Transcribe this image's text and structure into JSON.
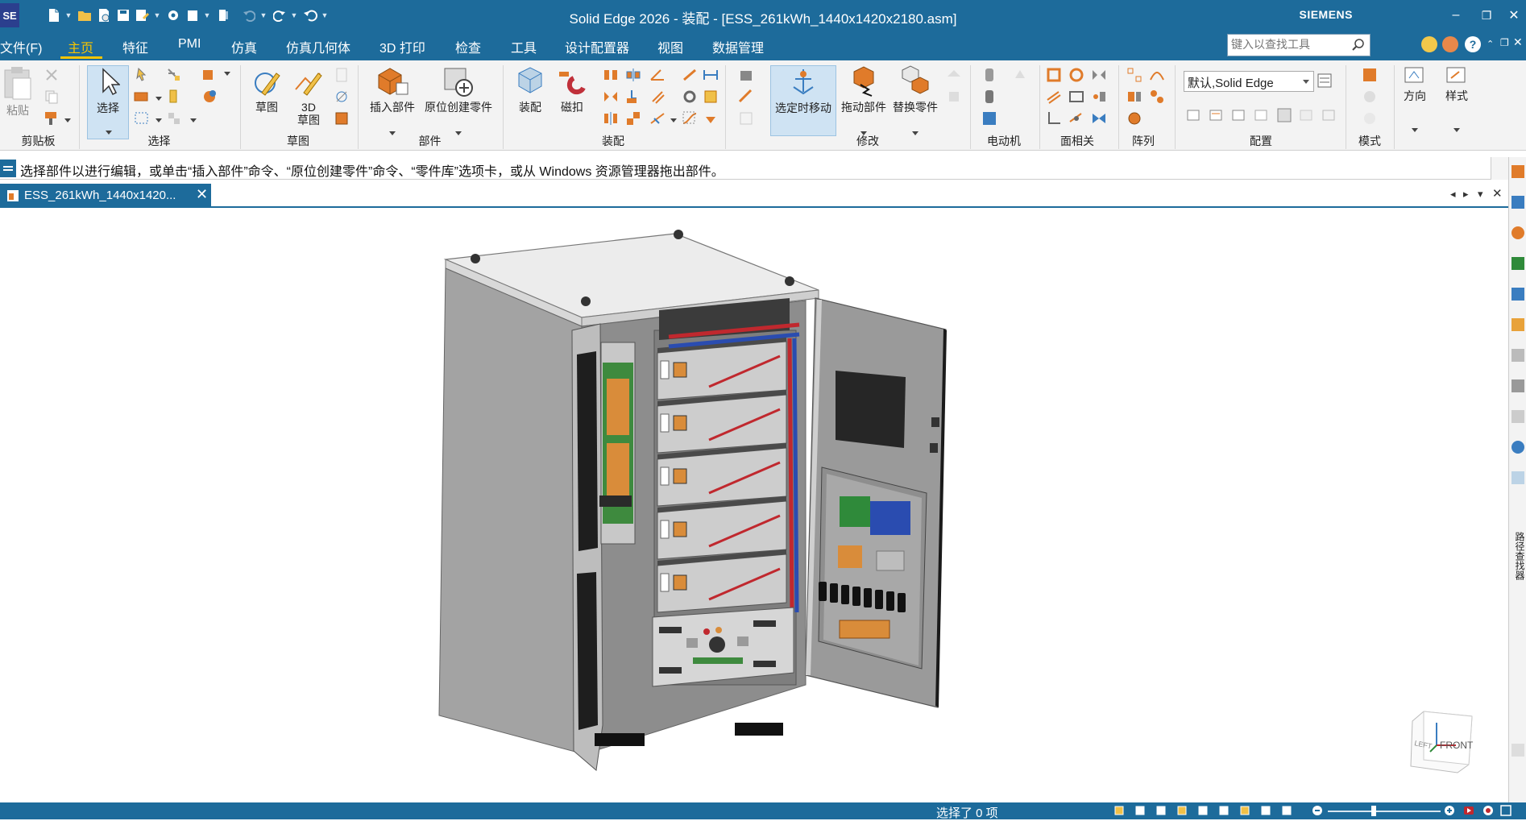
{
  "window": {
    "app_logo": "SE",
    "title": "Solid Edge 2026 - 装配 - [ESS_261kWh_1440x1420x2180.asm]",
    "brand": "SIEMENS",
    "minimize": "–",
    "restore": "❐",
    "close": "✕"
  },
  "menu": {
    "file": "文件(F)",
    "tabs": [
      "主页",
      "特征",
      "PMI",
      "仿真",
      "仿真几何体",
      "3D 打印",
      "检查",
      "工具",
      "设计配置器",
      "视图",
      "数据管理"
    ],
    "search_placeholder": "键入以查找工具"
  },
  "ribbon": {
    "groups": {
      "clipboard": "剪贴板",
      "select": "选择",
      "sketch": "草图",
      "parts": "部件",
      "assemble": "装配",
      "modify": "修改",
      "motor": "电动机",
      "face_relate": "面相关",
      "pattern": "阵列",
      "configuration": "配置",
      "mode": "模式"
    },
    "buttons": {
      "paste": "粘贴",
      "select": "选择",
      "sketch": "草图",
      "sketch3d_line1": "3D",
      "sketch3d_line2": "草图",
      "insert_part": "插入部件",
      "create_in_place": "原位创建零件",
      "assemble": "装配",
      "magnet": "磁扣",
      "move_on_select": "选定时移动",
      "drag_component": "拖动部件",
      "replace_part": "替换零件",
      "orient": "方向",
      "style": "样式"
    },
    "config_value": "默认,Solid Edge"
  },
  "prompt": {
    "text": "选择部件以进行编辑，或单击“插入部件”命令、“原位创建零件”命令、“零件库”选项卡，或从 Windows 资源管理器拖出部件。"
  },
  "document_tab": {
    "label": "ESS_261kWh_1440x1420...",
    "close": "✕"
  },
  "viewport": {
    "view_cube_face": "FRONT",
    "view_cube_side": "LEFT"
  },
  "right_dock": {
    "label": "路径查找器"
  },
  "status": {
    "text": "选择了 0 项"
  },
  "colors": {
    "titlebar": "#1d6b9b",
    "active_tab": "#f5c400",
    "ribbon_bg": "#f3f3f3",
    "cabinet_gray": "#9a9a9a"
  }
}
